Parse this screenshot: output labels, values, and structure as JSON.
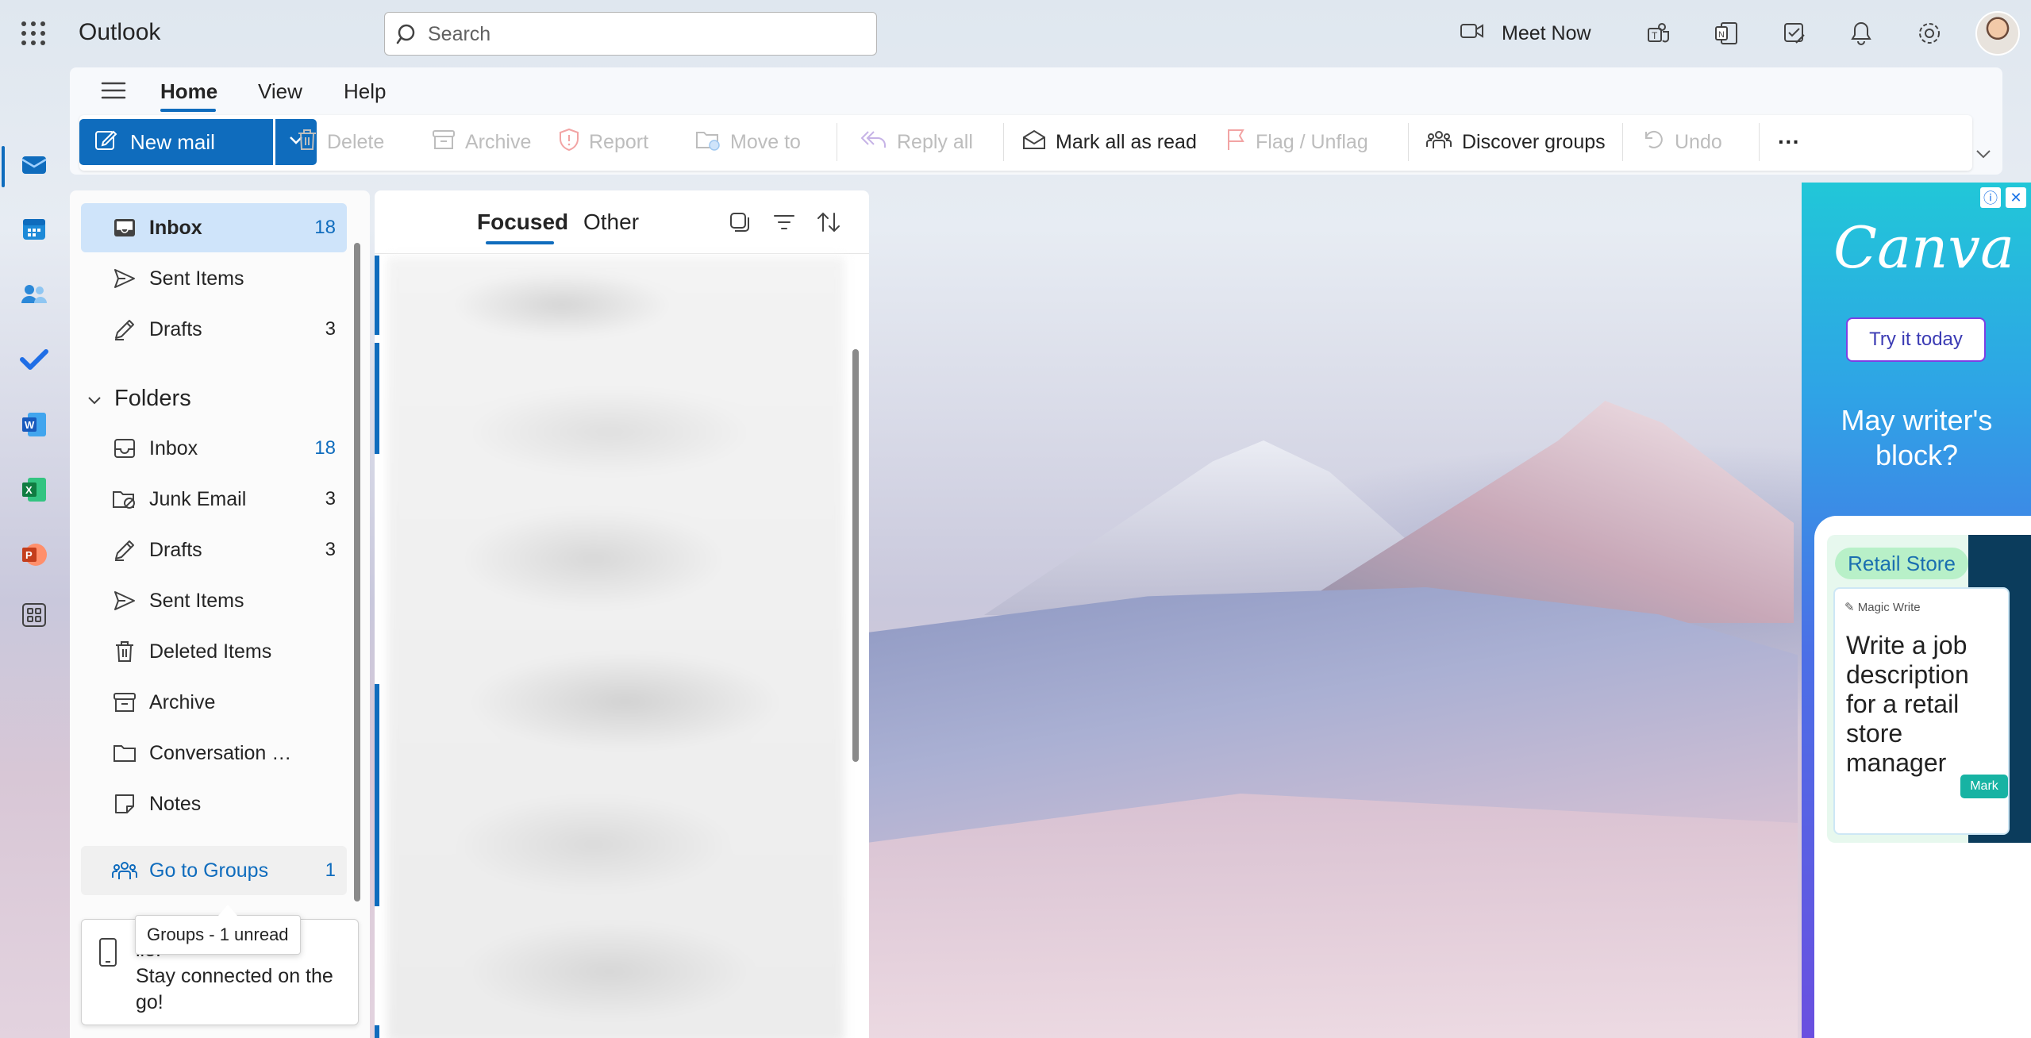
{
  "app": {
    "name": "Outlook"
  },
  "search": {
    "placeholder": "Search"
  },
  "topbar": {
    "meet_now_label": "Meet Now"
  },
  "ribbon": {
    "tabs": [
      {
        "label": "Home",
        "active": true
      },
      {
        "label": "View",
        "active": false
      },
      {
        "label": "Help",
        "active": false
      }
    ],
    "commands": {
      "new_mail": "New mail",
      "delete": "Delete",
      "archive": "Archive",
      "report": "Report",
      "move_to": "Move to",
      "reply_all": "Reply all",
      "mark_all_read": "Mark all as read",
      "flag_unflag": "Flag / Unflag",
      "discover_groups": "Discover groups",
      "undo": "Undo",
      "more": "···"
    }
  },
  "favorites": [
    {
      "label": "Inbox",
      "count": "18",
      "icon": "inbox-icon",
      "selected": true
    },
    {
      "label": "Sent Items",
      "count": "",
      "icon": "send-icon"
    },
    {
      "label": "Drafts",
      "count": "3",
      "icon": "drafts-icon"
    }
  ],
  "folders_header": "Folders",
  "folders": [
    {
      "label": "Inbox",
      "count": "18",
      "icon": "inbox-icon"
    },
    {
      "label": "Junk Email",
      "count": "3",
      "icon": "junk-icon"
    },
    {
      "label": "Drafts",
      "count": "3",
      "icon": "drafts-icon"
    },
    {
      "label": "Sent Items",
      "count": "",
      "icon": "send-icon"
    },
    {
      "label": "Deleted Items",
      "count": "",
      "icon": "trash-icon"
    },
    {
      "label": "Archive",
      "count": "",
      "icon": "archive-icon"
    },
    {
      "label": "Conversation Histo...",
      "count": "",
      "icon": "folder-icon"
    },
    {
      "label": "Notes",
      "count": "",
      "icon": "note-icon"
    }
  ],
  "groups": {
    "label": "Go to Groups",
    "count": "1"
  },
  "tooltip": "Groups - 1 unread",
  "promo": {
    "text": "ile.\nStay connected on the go!"
  },
  "message_list": {
    "pivots": [
      {
        "label": "Focused",
        "active": true
      },
      {
        "label": "Other",
        "active": false
      }
    ]
  },
  "ad": {
    "brand": "Canva",
    "cta": "Try it today",
    "headline": "May writer's block?",
    "store_chip": "Retail Store",
    "magic_write": "Magic Write",
    "card_text": "Write a job description for a retail store manager",
    "mark_label": "Mark"
  },
  "colors": {
    "accent": "#0f6cbd",
    "selected_bg": "#cfe4fa"
  }
}
